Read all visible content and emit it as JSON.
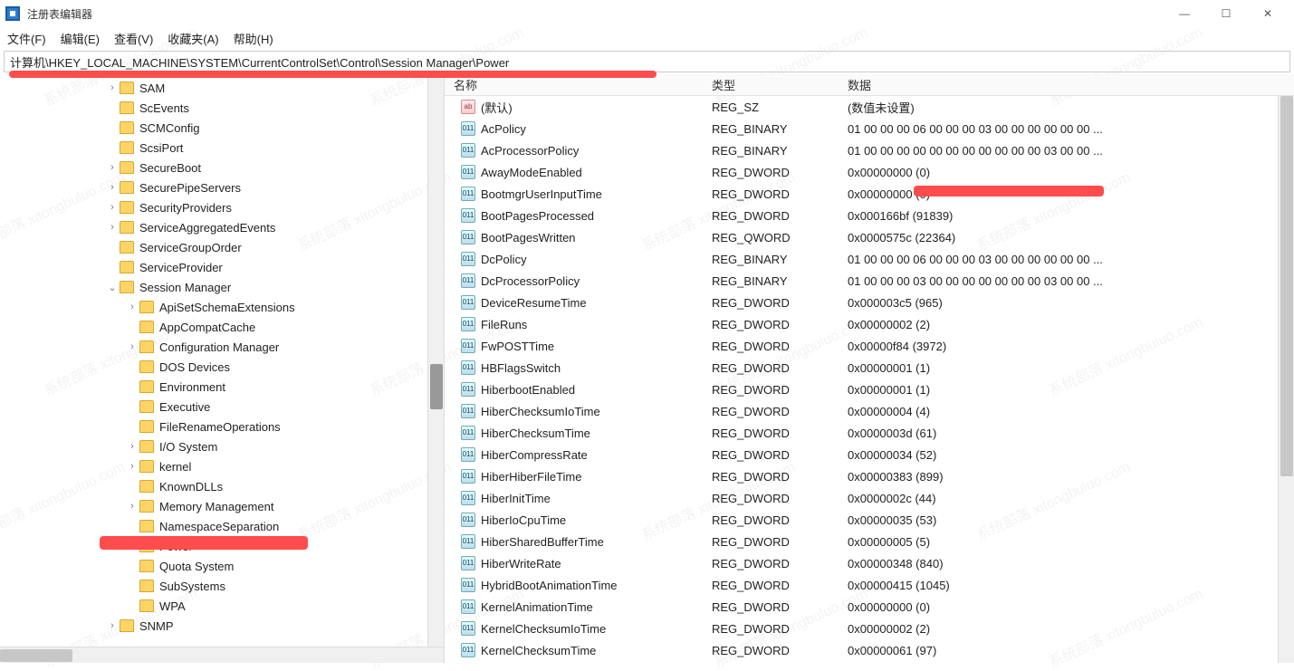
{
  "window": {
    "title": "注册表编辑器",
    "min": "—",
    "max": "☐",
    "close": "✕"
  },
  "menu": {
    "file": "文件(F)",
    "edit": "编辑(E)",
    "view": "查看(V)",
    "fav": "收藏夹(A)",
    "help": "帮助(H)"
  },
  "address": "计算机\\HKEY_LOCAL_MACHINE\\SYSTEM\\CurrentControlSet\\Control\\Session Manager\\Power",
  "treeItems": [
    {
      "indent": 5,
      "tw": ">",
      "label": "SAM"
    },
    {
      "indent": 5,
      "tw": "",
      "label": "ScEvents"
    },
    {
      "indent": 5,
      "tw": "",
      "label": "SCMConfig"
    },
    {
      "indent": 5,
      "tw": "",
      "label": "ScsiPort"
    },
    {
      "indent": 5,
      "tw": ">",
      "label": "SecureBoot"
    },
    {
      "indent": 5,
      "tw": ">",
      "label": "SecurePipeServers"
    },
    {
      "indent": 5,
      "tw": ">",
      "label": "SecurityProviders"
    },
    {
      "indent": 5,
      "tw": ">",
      "label": "ServiceAggregatedEvents"
    },
    {
      "indent": 5,
      "tw": "",
      "label": "ServiceGroupOrder"
    },
    {
      "indent": 5,
      "tw": "",
      "label": "ServiceProvider"
    },
    {
      "indent": 5,
      "tw": "v",
      "label": "Session Manager"
    },
    {
      "indent": 6,
      "tw": ">",
      "label": "ApiSetSchemaExtensions"
    },
    {
      "indent": 6,
      "tw": "",
      "label": "AppCompatCache"
    },
    {
      "indent": 6,
      "tw": ">",
      "label": "Configuration Manager"
    },
    {
      "indent": 6,
      "tw": "",
      "label": "DOS Devices"
    },
    {
      "indent": 6,
      "tw": "",
      "label": "Environment"
    },
    {
      "indent": 6,
      "tw": "",
      "label": "Executive"
    },
    {
      "indent": 6,
      "tw": "",
      "label": "FileRenameOperations"
    },
    {
      "indent": 6,
      "tw": ">",
      "label": "I/O System"
    },
    {
      "indent": 6,
      "tw": ">",
      "label": "kernel"
    },
    {
      "indent": 6,
      "tw": "",
      "label": "KnownDLLs"
    },
    {
      "indent": 6,
      "tw": ">",
      "label": "Memory Management"
    },
    {
      "indent": 6,
      "tw": "",
      "label": "NamespaceSeparation"
    },
    {
      "indent": 6,
      "tw": "",
      "label": "Power",
      "sel": true
    },
    {
      "indent": 6,
      "tw": "",
      "label": "Quota System"
    },
    {
      "indent": 6,
      "tw": "",
      "label": "SubSystems"
    },
    {
      "indent": 6,
      "tw": "",
      "label": "WPA"
    },
    {
      "indent": 5,
      "tw": ">",
      "label": "SNMP"
    }
  ],
  "columns": {
    "name": "名称",
    "type": "类型",
    "data": "数据"
  },
  "values": [
    {
      "icon": "ab",
      "name": "(默认)",
      "type": "REG_SZ",
      "data": "(数值未设置)"
    },
    {
      "icon": "bin",
      "name": "AcPolicy",
      "type": "REG_BINARY",
      "data": "01 00 00 00 06 00 00 00 03 00 00 00 00 00 00 ..."
    },
    {
      "icon": "bin",
      "name": "AcProcessorPolicy",
      "type": "REG_BINARY",
      "data": "01 00 00 00 00 00 00 00 00 00 00 00 03 00 00 ..."
    },
    {
      "icon": "bin",
      "name": "AwayModeEnabled",
      "type": "REG_DWORD",
      "data": "0x00000000 (0)"
    },
    {
      "icon": "bin",
      "name": "BootmgrUserInputTime",
      "type": "REG_DWORD",
      "data": "0x00000000 (0)"
    },
    {
      "icon": "bin",
      "name": "BootPagesProcessed",
      "type": "REG_DWORD",
      "data": "0x000166bf (91839)"
    },
    {
      "icon": "bin",
      "name": "BootPagesWritten",
      "type": "REG_QWORD",
      "data": "0x0000575c (22364)"
    },
    {
      "icon": "bin",
      "name": "DcPolicy",
      "type": "REG_BINARY",
      "data": "01 00 00 00 06 00 00 00 03 00 00 00 00 00 00 ..."
    },
    {
      "icon": "bin",
      "name": "DcProcessorPolicy",
      "type": "REG_BINARY",
      "data": "01 00 00 00 03 00 00 00 00 00 00 00 03 00 00 ..."
    },
    {
      "icon": "bin",
      "name": "DeviceResumeTime",
      "type": "REG_DWORD",
      "data": "0x000003c5 (965)"
    },
    {
      "icon": "bin",
      "name": "FileRuns",
      "type": "REG_DWORD",
      "data": "0x00000002 (2)"
    },
    {
      "icon": "bin",
      "name": "FwPOSTTime",
      "type": "REG_DWORD",
      "data": "0x00000f84 (3972)"
    },
    {
      "icon": "bin",
      "name": "HBFlagsSwitch",
      "type": "REG_DWORD",
      "data": "0x00000001 (1)"
    },
    {
      "icon": "bin",
      "name": "HiberbootEnabled",
      "type": "REG_DWORD",
      "data": "0x00000001 (1)"
    },
    {
      "icon": "bin",
      "name": "HiberChecksumIoTime",
      "type": "REG_DWORD",
      "data": "0x00000004 (4)"
    },
    {
      "icon": "bin",
      "name": "HiberChecksumTime",
      "type": "REG_DWORD",
      "data": "0x0000003d (61)"
    },
    {
      "icon": "bin",
      "name": "HiberCompressRate",
      "type": "REG_DWORD",
      "data": "0x00000034 (52)"
    },
    {
      "icon": "bin",
      "name": "HiberHiberFileTime",
      "type": "REG_DWORD",
      "data": "0x00000383 (899)"
    },
    {
      "icon": "bin",
      "name": "HiberInitTime",
      "type": "REG_DWORD",
      "data": "0x0000002c (44)"
    },
    {
      "icon": "bin",
      "name": "HiberIoCpuTime",
      "type": "REG_DWORD",
      "data": "0x00000035 (53)"
    },
    {
      "icon": "bin",
      "name": "HiberSharedBufferTime",
      "type": "REG_DWORD",
      "data": "0x00000005 (5)"
    },
    {
      "icon": "bin",
      "name": "HiberWriteRate",
      "type": "REG_DWORD",
      "data": "0x00000348 (840)"
    },
    {
      "icon": "bin",
      "name": "HybridBootAnimationTime",
      "type": "REG_DWORD",
      "data": "0x00000415 (1045)"
    },
    {
      "icon": "bin",
      "name": "KernelAnimationTime",
      "type": "REG_DWORD",
      "data": "0x00000000 (0)"
    },
    {
      "icon": "bin",
      "name": "KernelChecksumIoTime",
      "type": "REG_DWORD",
      "data": "0x00000002 (2)"
    },
    {
      "icon": "bin",
      "name": "KernelChecksumTime",
      "type": "REG_DWORD",
      "data": "0x00000061 (97)"
    }
  ],
  "watermark": "系统部落 xitongbuluo.com"
}
